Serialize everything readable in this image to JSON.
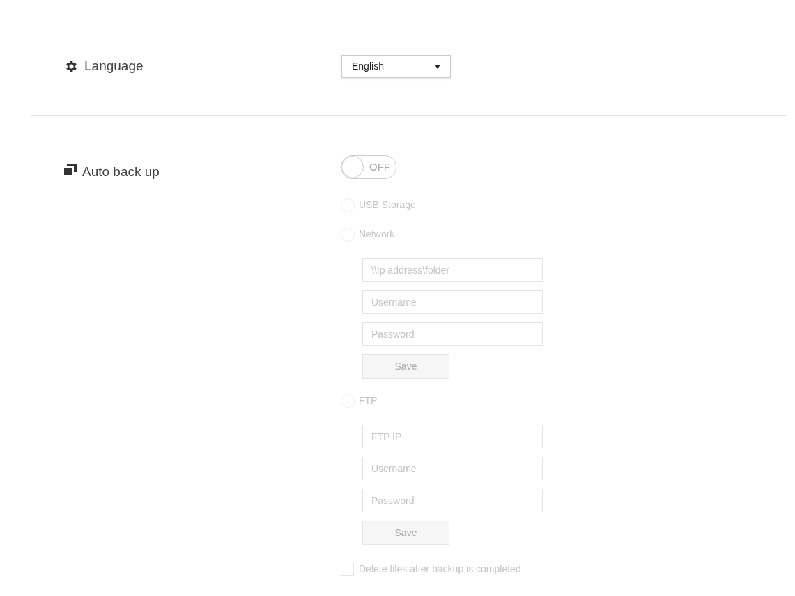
{
  "language": {
    "label": "Language",
    "select": {
      "value": "English"
    }
  },
  "auto_backup": {
    "label": "Auto back up",
    "toggle": {
      "on": false,
      "text": "OFF"
    },
    "disabled": true,
    "targets": [
      {
        "label": "USB Storage",
        "selected": false
      },
      {
        "label": "Network",
        "selected": false,
        "fields": [
          {
            "placeholder": "\\\\Ip address\\folder"
          },
          {
            "placeholder": "Username"
          },
          {
            "placeholder": "Password"
          }
        ],
        "button": "Save"
      },
      {
        "label": "FTP",
        "selected": false,
        "fields": [
          {
            "placeholder": "FTP IP"
          },
          {
            "placeholder": "Username"
          },
          {
            "placeholder": "Password"
          }
        ],
        "button": "Save"
      }
    ],
    "delete_option": {
      "label": "Delete files after backup is completed",
      "checked": false
    }
  }
}
